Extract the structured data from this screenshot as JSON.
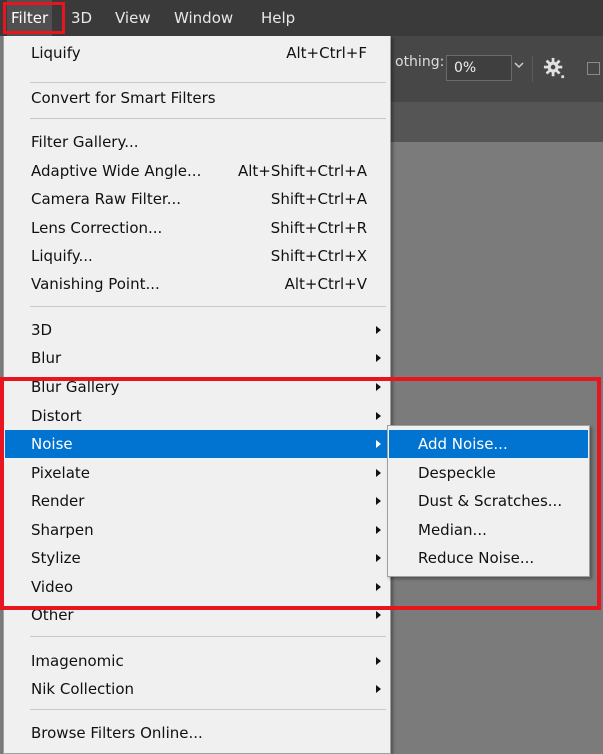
{
  "menubar": {
    "items": [
      {
        "label": "Filter"
      },
      {
        "label": "3D"
      },
      {
        "label": "View"
      },
      {
        "label": "Window"
      },
      {
        "label": "Help"
      }
    ]
  },
  "options_bar": {
    "smoothing_label": "othing:",
    "smoothing_value": "0%"
  },
  "filter_menu": {
    "items": [
      {
        "label": "Liquify",
        "shortcut": "Alt+Ctrl+F"
      },
      {
        "label": "Convert for Smart Filters",
        "shortcut": ""
      },
      {
        "label": "Filter Gallery...",
        "shortcut": ""
      },
      {
        "label": "Adaptive Wide Angle...",
        "shortcut": "Alt+Shift+Ctrl+A"
      },
      {
        "label": "Camera Raw Filter...",
        "shortcut": "Shift+Ctrl+A"
      },
      {
        "label": "Lens Correction...",
        "shortcut": "Shift+Ctrl+R"
      },
      {
        "label": "Liquify...",
        "shortcut": "Shift+Ctrl+X"
      },
      {
        "label": "Vanishing Point...",
        "shortcut": "Alt+Ctrl+V"
      },
      {
        "label": "3D",
        "shortcut": ""
      },
      {
        "label": "Blur",
        "shortcut": ""
      },
      {
        "label": "Blur Gallery",
        "shortcut": ""
      },
      {
        "label": "Distort",
        "shortcut": ""
      },
      {
        "label": "Noise",
        "shortcut": ""
      },
      {
        "label": "Pixelate",
        "shortcut": ""
      },
      {
        "label": "Render",
        "shortcut": ""
      },
      {
        "label": "Sharpen",
        "shortcut": ""
      },
      {
        "label": "Stylize",
        "shortcut": ""
      },
      {
        "label": "Video",
        "shortcut": ""
      },
      {
        "label": "Other",
        "shortcut": ""
      },
      {
        "label": "Imagenomic",
        "shortcut": ""
      },
      {
        "label": "Nik Collection",
        "shortcut": ""
      },
      {
        "label": "Browse Filters Online...",
        "shortcut": ""
      }
    ]
  },
  "noise_submenu": {
    "items": [
      {
        "label": "Add Noise..."
      },
      {
        "label": "Despeckle"
      },
      {
        "label": "Dust & Scratches..."
      },
      {
        "label": "Median..."
      },
      {
        "label": "Reduce Noise..."
      }
    ]
  },
  "colors": {
    "highlight": "#0074d0",
    "annotation_red": "#e8141f"
  }
}
